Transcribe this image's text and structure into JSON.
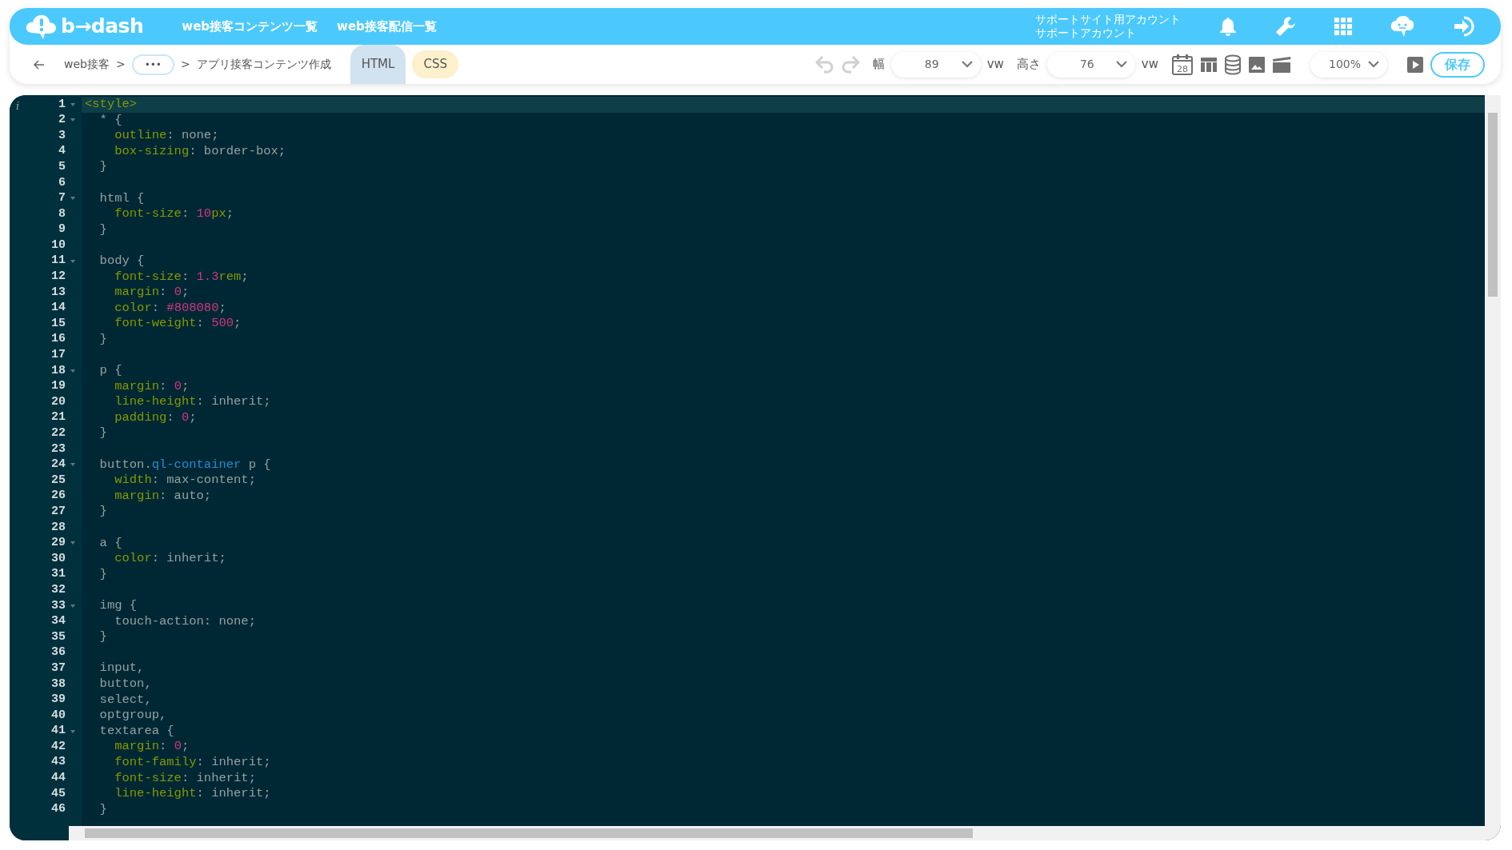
{
  "header": {
    "logo_text": "b→dash",
    "nav": [
      "web接客コンテンツ一覧",
      "web接客配信一覧"
    ],
    "account": [
      "サポートサイト用アカウント",
      "サポートアカウント"
    ]
  },
  "toolbar": {
    "breadcrumbs": [
      {
        "kind": "link",
        "text": "web接客"
      },
      {
        "kind": "sep",
        "text": ">"
      },
      {
        "kind": "more",
        "text": "•••"
      },
      {
        "kind": "sep",
        "text": ">"
      },
      {
        "kind": "current",
        "text": "アプリ接客コンテンツ作成"
      }
    ],
    "tabs": [
      {
        "label": "HTML",
        "selected": true
      },
      {
        "label": "CSS",
        "selected": false
      }
    ],
    "history": [
      {
        "kind": "undo",
        "disabled": true
      },
      {
        "kind": "redo",
        "disabled": true
      }
    ],
    "width": {
      "label": "幅",
      "value": "89",
      "unit": "vw"
    },
    "height": {
      "label": "高さ",
      "value": "76",
      "unit": "vw"
    },
    "calendar_day": "28",
    "zoom": "100%",
    "save": "保存"
  },
  "editor": {
    "info_marker": "i",
    "lines": [
      {
        "n": "1",
        "fold": true,
        "active": true,
        "tokens": [
          {
            "kind": "tag",
            "text": "<style>"
          }
        ]
      },
      {
        "n": "2",
        "fold": true,
        "active": false,
        "tokens": [
          {
            "kind": "plain",
            "text": "  * {"
          }
        ]
      },
      {
        "n": "3",
        "fold": false,
        "active": false,
        "tokens": [
          {
            "kind": "prop",
            "text": "    outline"
          },
          {
            "kind": "plain",
            "text": ": none;"
          }
        ]
      },
      {
        "n": "4",
        "fold": false,
        "active": false,
        "tokens": [
          {
            "kind": "prop",
            "text": "    box-sizing"
          },
          {
            "kind": "plain",
            "text": ": border-box;"
          }
        ]
      },
      {
        "n": "5",
        "fold": false,
        "active": false,
        "tokens": [
          {
            "kind": "plain",
            "text": "  }"
          }
        ]
      },
      {
        "n": "6",
        "fold": false,
        "active": false
      },
      {
        "n": "7",
        "fold": true,
        "active": false,
        "tokens": [
          {
            "kind": "plain",
            "text": "  html {"
          }
        ]
      },
      {
        "n": "8",
        "fold": false,
        "active": false,
        "tokens": [
          {
            "kind": "prop",
            "text": "    font-size"
          },
          {
            "kind": "plain",
            "text": ": "
          },
          {
            "kind": "num",
            "text": "10"
          },
          {
            "kind": "prop",
            "text": "px"
          },
          {
            "kind": "plain",
            "text": ";"
          }
        ]
      },
      {
        "n": "9",
        "fold": false,
        "active": false,
        "tokens": [
          {
            "kind": "plain",
            "text": "  }"
          }
        ]
      },
      {
        "n": "10",
        "fold": false,
        "active": false
      },
      {
        "n": "11",
        "fold": true,
        "active": false,
        "tokens": [
          {
            "kind": "plain",
            "text": "  body {"
          }
        ]
      },
      {
        "n": "12",
        "fold": false,
        "active": false,
        "tokens": [
          {
            "kind": "prop",
            "text": "    font-size"
          },
          {
            "kind": "plain",
            "text": ": "
          },
          {
            "kind": "num",
            "text": "1.3"
          },
          {
            "kind": "prop",
            "text": "rem"
          },
          {
            "kind": "plain",
            "text": ";"
          }
        ]
      },
      {
        "n": "13",
        "fold": false,
        "active": false,
        "tokens": [
          {
            "kind": "prop",
            "text": "    margin"
          },
          {
            "kind": "plain",
            "text": ": "
          },
          {
            "kind": "num",
            "text": "0"
          },
          {
            "kind": "plain",
            "text": ";"
          }
        ]
      },
      {
        "n": "14",
        "fold": false,
        "active": false,
        "tokens": [
          {
            "kind": "prop",
            "text": "    color"
          },
          {
            "kind": "plain",
            "text": ": "
          },
          {
            "kind": "num",
            "text": "#808080"
          },
          {
            "kind": "plain",
            "text": ";"
          }
        ]
      },
      {
        "n": "15",
        "fold": false,
        "active": false,
        "tokens": [
          {
            "kind": "prop",
            "text": "    font-weight"
          },
          {
            "kind": "plain",
            "text": ": "
          },
          {
            "kind": "num",
            "text": "500"
          },
          {
            "kind": "plain",
            "text": ";"
          }
        ]
      },
      {
        "n": "16",
        "fold": false,
        "active": false,
        "tokens": [
          {
            "kind": "plain",
            "text": "  }"
          }
        ]
      },
      {
        "n": "17",
        "fold": false,
        "active": false
      },
      {
        "n": "18",
        "fold": true,
        "active": false,
        "tokens": [
          {
            "kind": "plain",
            "text": "  p {"
          }
        ]
      },
      {
        "n": "19",
        "fold": false,
        "active": false,
        "tokens": [
          {
            "kind": "prop",
            "text": "    margin"
          },
          {
            "kind": "plain",
            "text": ": "
          },
          {
            "kind": "num",
            "text": "0"
          },
          {
            "kind": "plain",
            "text": ";"
          }
        ]
      },
      {
        "n": "20",
        "fold": false,
        "active": false,
        "tokens": [
          {
            "kind": "prop",
            "text": "    line-height"
          },
          {
            "kind": "plain",
            "text": ": inherit;"
          }
        ]
      },
      {
        "n": "21",
        "fold": false,
        "active": false,
        "tokens": [
          {
            "kind": "prop",
            "text": "    padding"
          },
          {
            "kind": "plain",
            "text": ": "
          },
          {
            "kind": "num",
            "text": "0"
          },
          {
            "kind": "plain",
            "text": ";"
          }
        ]
      },
      {
        "n": "22",
        "fold": false,
        "active": false,
        "tokens": [
          {
            "kind": "plain",
            "text": "  }"
          }
        ]
      },
      {
        "n": "23",
        "fold": false,
        "active": false
      },
      {
        "n": "24",
        "fold": true,
        "active": false,
        "tokens": [
          {
            "kind": "plain",
            "text": "  button."
          },
          {
            "kind": "class",
            "text": "ql-container"
          },
          {
            "kind": "plain",
            "text": " p {"
          }
        ]
      },
      {
        "n": "25",
        "fold": false,
        "active": false,
        "tokens": [
          {
            "kind": "prop",
            "text": "    width"
          },
          {
            "kind": "plain",
            "text": ": max-content;"
          }
        ]
      },
      {
        "n": "26",
        "fold": false,
        "active": false,
        "tokens": [
          {
            "kind": "prop",
            "text": "    margin"
          },
          {
            "kind": "plain",
            "text": ": auto;"
          }
        ]
      },
      {
        "n": "27",
        "fold": false,
        "active": false,
        "tokens": [
          {
            "kind": "plain",
            "text": "  }"
          }
        ]
      },
      {
        "n": "28",
        "fold": false,
        "active": false
      },
      {
        "n": "29",
        "fold": true,
        "active": false,
        "tokens": [
          {
            "kind": "plain",
            "text": "  a {"
          }
        ]
      },
      {
        "n": "30",
        "fold": false,
        "active": false,
        "tokens": [
          {
            "kind": "prop",
            "text": "    color"
          },
          {
            "kind": "plain",
            "text": ": inherit;"
          }
        ]
      },
      {
        "n": "31",
        "fold": false,
        "active": false,
        "tokens": [
          {
            "kind": "plain",
            "text": "  }"
          }
        ]
      },
      {
        "n": "32",
        "fold": false,
        "active": false
      },
      {
        "n": "33",
        "fold": true,
        "active": false,
        "tokens": [
          {
            "kind": "plain",
            "text": "  img {"
          }
        ]
      },
      {
        "n": "34",
        "fold": false,
        "active": false,
        "tokens": [
          {
            "kind": "plain",
            "text": "    touch-action: none;"
          }
        ]
      },
      {
        "n": "35",
        "fold": false,
        "active": false,
        "tokens": [
          {
            "kind": "plain",
            "text": "  }"
          }
        ]
      },
      {
        "n": "36",
        "fold": false,
        "active": false
      },
      {
        "n": "37",
        "fold": false,
        "active": false,
        "tokens": [
          {
            "kind": "plain",
            "text": "  input,"
          }
        ]
      },
      {
        "n": "38",
        "fold": false,
        "active": false,
        "tokens": [
          {
            "kind": "plain",
            "text": "  button,"
          }
        ]
      },
      {
        "n": "39",
        "fold": false,
        "active": false,
        "tokens": [
          {
            "kind": "plain",
            "text": "  select,"
          }
        ]
      },
      {
        "n": "40",
        "fold": false,
        "active": false,
        "tokens": [
          {
            "kind": "plain",
            "text": "  optgroup,"
          }
        ]
      },
      {
        "n": "41",
        "fold": true,
        "active": false,
        "tokens": [
          {
            "kind": "plain",
            "text": "  textarea {"
          }
        ]
      },
      {
        "n": "42",
        "fold": false,
        "active": false,
        "tokens": [
          {
            "kind": "prop",
            "text": "    margin"
          },
          {
            "kind": "plain",
            "text": ": "
          },
          {
            "kind": "num",
            "text": "0"
          },
          {
            "kind": "plain",
            "text": ";"
          }
        ]
      },
      {
        "n": "43",
        "fold": false,
        "active": false,
        "tokens": [
          {
            "kind": "prop",
            "text": "    font-family"
          },
          {
            "kind": "plain",
            "text": ": inherit;"
          }
        ]
      },
      {
        "n": "44",
        "fold": false,
        "active": false,
        "tokens": [
          {
            "kind": "prop",
            "text": "    font-size"
          },
          {
            "kind": "plain",
            "text": ": inherit;"
          }
        ]
      },
      {
        "n": "45",
        "fold": false,
        "active": false,
        "tokens": [
          {
            "kind": "prop",
            "text": "    line-height"
          },
          {
            "kind": "plain",
            "text": ": inherit;"
          }
        ]
      },
      {
        "n": "46",
        "fold": false,
        "active": false,
        "tokens": [
          {
            "kind": "plain",
            "text": "  }"
          }
        ]
      }
    ]
  }
}
